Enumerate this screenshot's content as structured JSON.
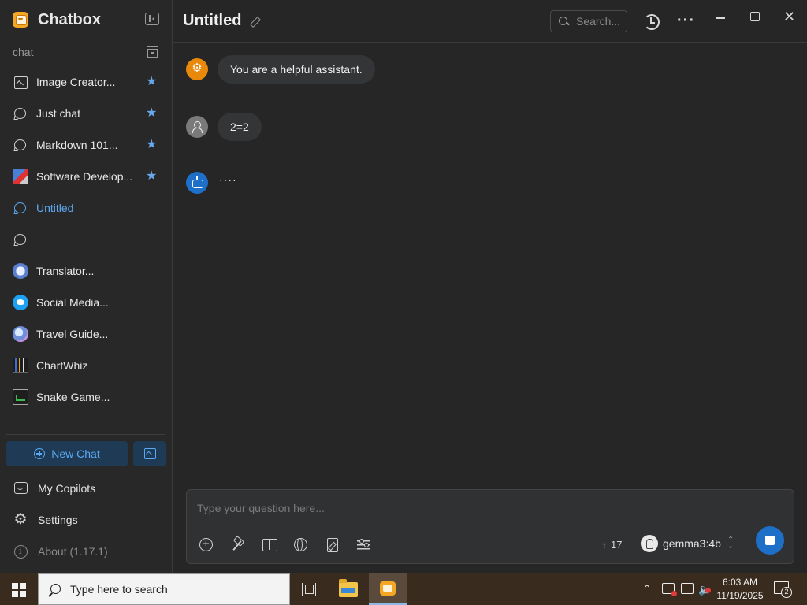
{
  "app": {
    "name": "Chatbox",
    "icons": {
      "logo": "chatbox-logo-icon",
      "collapse": "sidebar-collapse-icon"
    }
  },
  "sidebar": {
    "section_label": "chat",
    "archive_icon": "archive-icon",
    "items": [
      {
        "label": "Image Creator...",
        "icon": "image-icon",
        "starred": true
      },
      {
        "label": "Just chat",
        "icon": "chat-bubble-icon",
        "starred": true
      },
      {
        "label": "Markdown 101...",
        "icon": "chat-bubble-icon",
        "starred": true
      },
      {
        "label": "Software Develop...",
        "icon": "software-dev-avatar",
        "starred": true
      },
      {
        "label": "Untitled",
        "icon": "chat-bubble-icon",
        "starred": false,
        "active": true
      },
      {
        "label": "",
        "icon": "chat-bubble-icon",
        "starred": false
      },
      {
        "label": "Translator...",
        "icon": "translator-avatar",
        "starred": false
      },
      {
        "label": "Social Media...",
        "icon": "social-media-avatar",
        "starred": false
      },
      {
        "label": "Travel Guide...",
        "icon": "travel-guide-avatar",
        "starred": false
      },
      {
        "label": "ChartWhiz",
        "icon": "chartwhiz-avatar",
        "starred": false
      },
      {
        "label": "Snake Game...",
        "icon": "snake-game-avatar",
        "starred": false
      }
    ],
    "new_chat_label": "New Chat",
    "bottom": {
      "copilots_label": "My Copilots",
      "settings_label": "Settings",
      "about_label": "About (1.17.1)"
    }
  },
  "header": {
    "title": "Untitled",
    "search_placeholder": "Search..."
  },
  "messages": [
    {
      "role": "system",
      "text": "You are a helpful assistant."
    },
    {
      "role": "user",
      "text": "2=2"
    },
    {
      "role": "assistant",
      "text": "····"
    }
  ],
  "composer": {
    "placeholder": "Type your question here...",
    "token_count": "17",
    "model_name": "gemma3:4b"
  },
  "taskbar": {
    "search_placeholder": "Type here to search",
    "time": "6:03 AM",
    "date": "11/19/2025",
    "notification_count": "2"
  },
  "colors": {
    "accent": "#5aa9f2",
    "primary_button": "#1e6fc8",
    "star": "#6aa8ee",
    "system_avatar": "#e8890c",
    "background": "#262626"
  }
}
